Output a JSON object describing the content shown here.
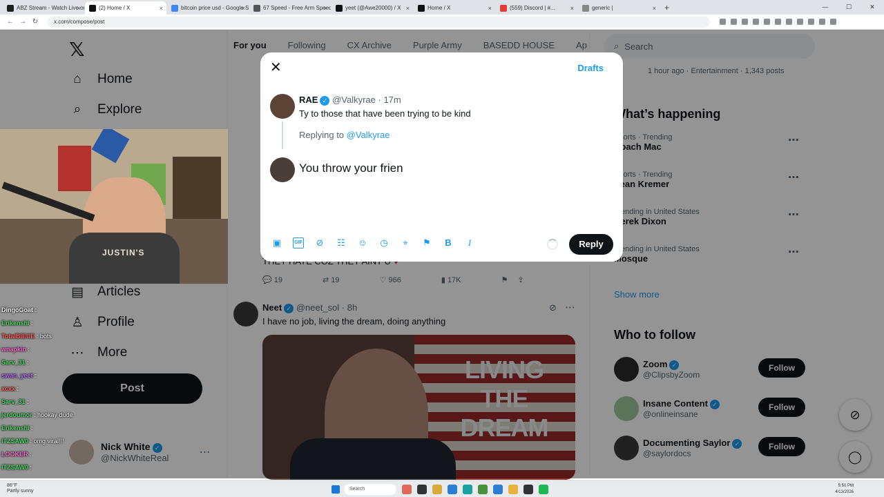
{
  "browser": {
    "tabs": [
      {
        "label": "ABZ Stream - Watch Live on Ci",
        "color": "#1f1f1f"
      },
      {
        "label": "(2) Home / X",
        "color": "#111111",
        "active": true
      },
      {
        "label": "bitcoin price usd - Google Sea",
        "color": "#4285f4"
      },
      {
        "label": "67 Speed - Free Arm Speed Ch",
        "color": "#555555"
      },
      {
        "label": "yeet (@Awe20000) / X",
        "color": "#111111"
      },
      {
        "label": "Home / X",
        "color": "#111111"
      },
      {
        "label": "(559) Discord | #...",
        "color": "#e33a3a"
      },
      {
        "label": "generic |",
        "color": "#888888"
      }
    ],
    "url": "x.com/compose/post"
  },
  "left_nav": {
    "home": "Home",
    "explore": "Explore",
    "articles": "Articles",
    "profile": "Profile",
    "more": "More",
    "post": "Post"
  },
  "account": {
    "name": "Nick White",
    "handle": "@NickWhiteReal"
  },
  "webcam": {
    "shirt_text": "JUSTIN'S"
  },
  "chat": [
    {
      "name": "DingoGoat",
      "color": "#ffffff",
      "msg": ""
    },
    {
      "name": "Erikenshi",
      "color": "#4cd964",
      "msg": ""
    },
    {
      "name": "TotalBIECE",
      "color": "#ff5a5a",
      "msg": "bots"
    },
    {
      "name": "wnapkin",
      "color": "#ff6bd6",
      "msg": ""
    },
    {
      "name": "Sarv_31",
      "color": "#4cd964",
      "msg": ""
    },
    {
      "name": "swan_yeet",
      "color": "#b86bff",
      "msg": ""
    },
    {
      "name": "xcxx",
      "color": "#ff5a5a",
      "msg": ""
    },
    {
      "name": "Sarv_31",
      "color": "#4cd964",
      "msg": ""
    },
    {
      "name": "jerdoumor",
      "color": "#4cd964",
      "msg": "hookay dude"
    },
    {
      "name": "Erikenshi",
      "color": "#4cd964",
      "msg": ""
    },
    {
      "name": "ITZSAW0",
      "color": "#4cd964",
      "msg": "omg viral!!!"
    },
    {
      "name": "LOOKER",
      "color": "#ff6bd6",
      "msg": ""
    },
    {
      "name": "ITZSAW0",
      "color": "#4cd964",
      "msg": ""
    }
  ],
  "feed_tabs": [
    "For you",
    "Following",
    "CX Archive",
    "Purple Army",
    "BASEDD HOUSE",
    "Ape"
  ],
  "tweet1": {
    "text": "THEY HATE COZ THEY AINT U",
    "replies": "19",
    "reposts": "19",
    "likes": "966",
    "views": "17K"
  },
  "tweet2": {
    "name": "Neet",
    "handle": "@neet_sol",
    "time": "8h",
    "text": "I have no job, living the dream, doing anything",
    "media_caption": "LIVING THE DREAM"
  },
  "right": {
    "search_placeholder": "Search",
    "trend_top_meta": "1 hour ago · Entertainment · 1,343 posts",
    "whats_happening": "What’s happening",
    "trends": [
      {
        "cat": "Sports · Trending",
        "name": "Coach Mac"
      },
      {
        "cat": "Sports · Trending",
        "name": "Sean Kremer"
      },
      {
        "cat": "Trending in United States",
        "name": "Derek Dixon"
      },
      {
        "cat": "Trending in United States",
        "name": "Mosque"
      }
    ],
    "show_more": "Show more",
    "who_to_follow": "Who to follow",
    "follows": [
      {
        "name": "Zoom",
        "handle": "@ClipsbyZoom",
        "color": "#2a2a2a"
      },
      {
        "name": "Insane Content",
        "handle": "@onlineinsane",
        "color": "#9ec79a"
      },
      {
        "name": "Documenting Saylor",
        "handle": "@saylordocs",
        "color": "#3a3a3a"
      }
    ],
    "follow_label": "Follow"
  },
  "modal": {
    "drafts": "Drafts",
    "author_name": "RAE",
    "author_handle": "@Valkyrae",
    "author_time": "· 17m",
    "tweet_text": "Ty to those that have been trying to be kind",
    "replying_prefix": "Replying to",
    "replying_handle": "@Valkyrae",
    "draft_text": "You throw your frien",
    "reply_button": "Reply"
  },
  "taskbar": {
    "weather_temp": "86°F",
    "weather_desc": "Partly sunny",
    "search": "Search",
    "time": "5:50 PM",
    "date": "4/13/2026"
  }
}
